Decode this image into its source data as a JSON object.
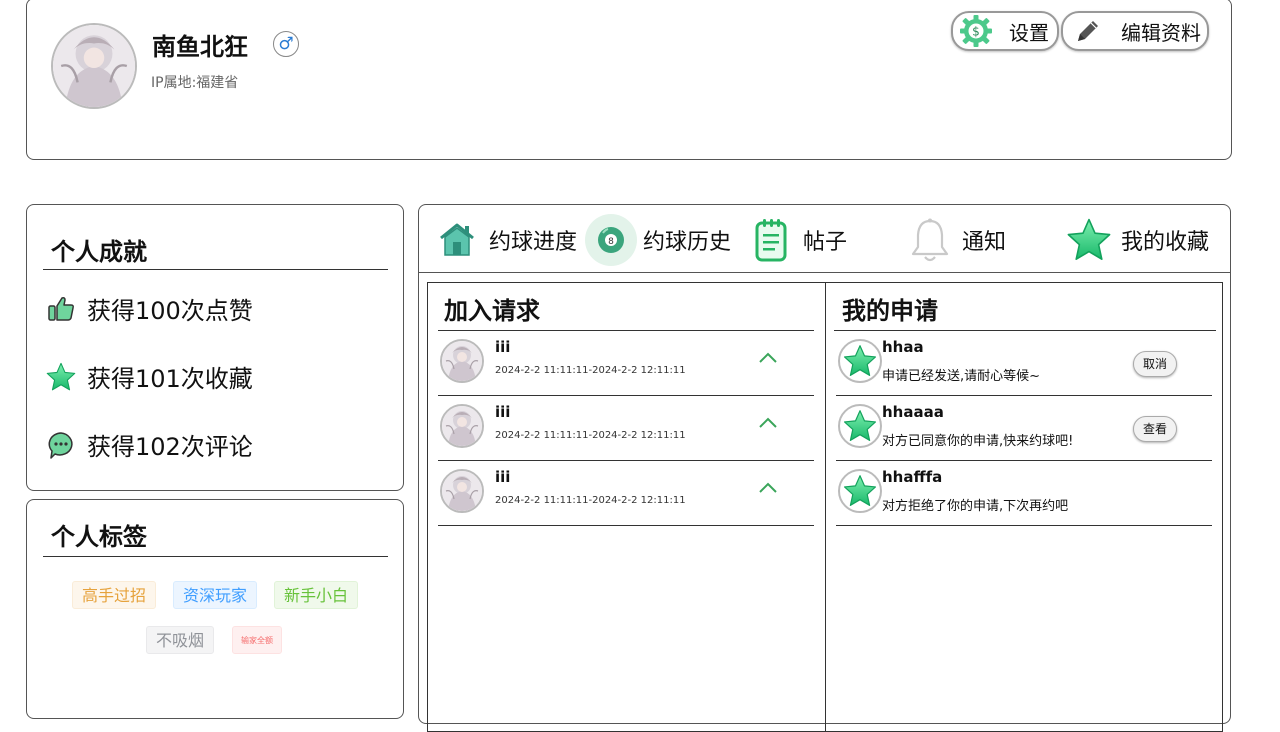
{
  "profile": {
    "username": "南鱼北狂",
    "gender_symbol": "♂",
    "ip_location": "IP属地:福建省",
    "settings_label": "设置",
    "edit_label": "编辑资料"
  },
  "achievements": {
    "title": "个人成就",
    "items": [
      {
        "icon": "thumbs-up-icon",
        "text": "获得100次点赞"
      },
      {
        "icon": "star-icon",
        "text": "获得101次收藏"
      },
      {
        "icon": "comment-icon",
        "text": "获得102次评论"
      }
    ]
  },
  "tags": {
    "title": "个人标签",
    "items": [
      {
        "text": "高手过招",
        "color": "#e6a23c",
        "bg": "#fdf6ec",
        "border": "#faecd8"
      },
      {
        "text": "资深玩家",
        "color": "#409eff",
        "bg": "#ecf5ff",
        "border": "#d9ecff"
      },
      {
        "text": "新手小白",
        "color": "#67c23a",
        "bg": "#f0f9eb",
        "border": "#e1f3d8"
      },
      {
        "text": "不吸烟",
        "color": "#909399",
        "bg": "#f4f4f5",
        "border": "#e9e9eb"
      },
      {
        "text": "输家全额",
        "color": "#f56c6c",
        "bg": "#fef0f0",
        "border": "#fde2e2"
      }
    ]
  },
  "tabs": [
    {
      "label": "约球进度",
      "icon": "house-icon"
    },
    {
      "label": "约球历史",
      "icon": "billiard-ball-icon"
    },
    {
      "label": "帖子",
      "icon": "clipboard-icon"
    },
    {
      "label": "通知",
      "icon": "bell-icon"
    },
    {
      "label": "我的收藏",
      "icon": "star-icon"
    }
  ],
  "join_requests": {
    "title": "加入请求",
    "items": [
      {
        "name": "iii",
        "time": "2024-2-2 11:11:11-2024-2-2 12:11:11"
      },
      {
        "name": "iii",
        "time": "2024-2-2 11:11:11-2024-2-2 12:11:11"
      },
      {
        "name": "iii",
        "time": "2024-2-2 11:11:11-2024-2-2 12:11:11"
      }
    ]
  },
  "my_applications": {
    "title": "我的申请",
    "items": [
      {
        "name": "hhaa",
        "message": "申请已经发送,请耐心等候~",
        "action": "取消"
      },
      {
        "name": "hhaaaa",
        "message": "对方已同意你的申请,快来约球吧!",
        "action": "查看"
      },
      {
        "name": "hhafffa",
        "message": "对方拒绝了你的申请,下次再约吧",
        "action": ""
      }
    ]
  },
  "colors": {
    "accent_green": "#3ecf8e",
    "chevron_green": "#3aa55a"
  }
}
